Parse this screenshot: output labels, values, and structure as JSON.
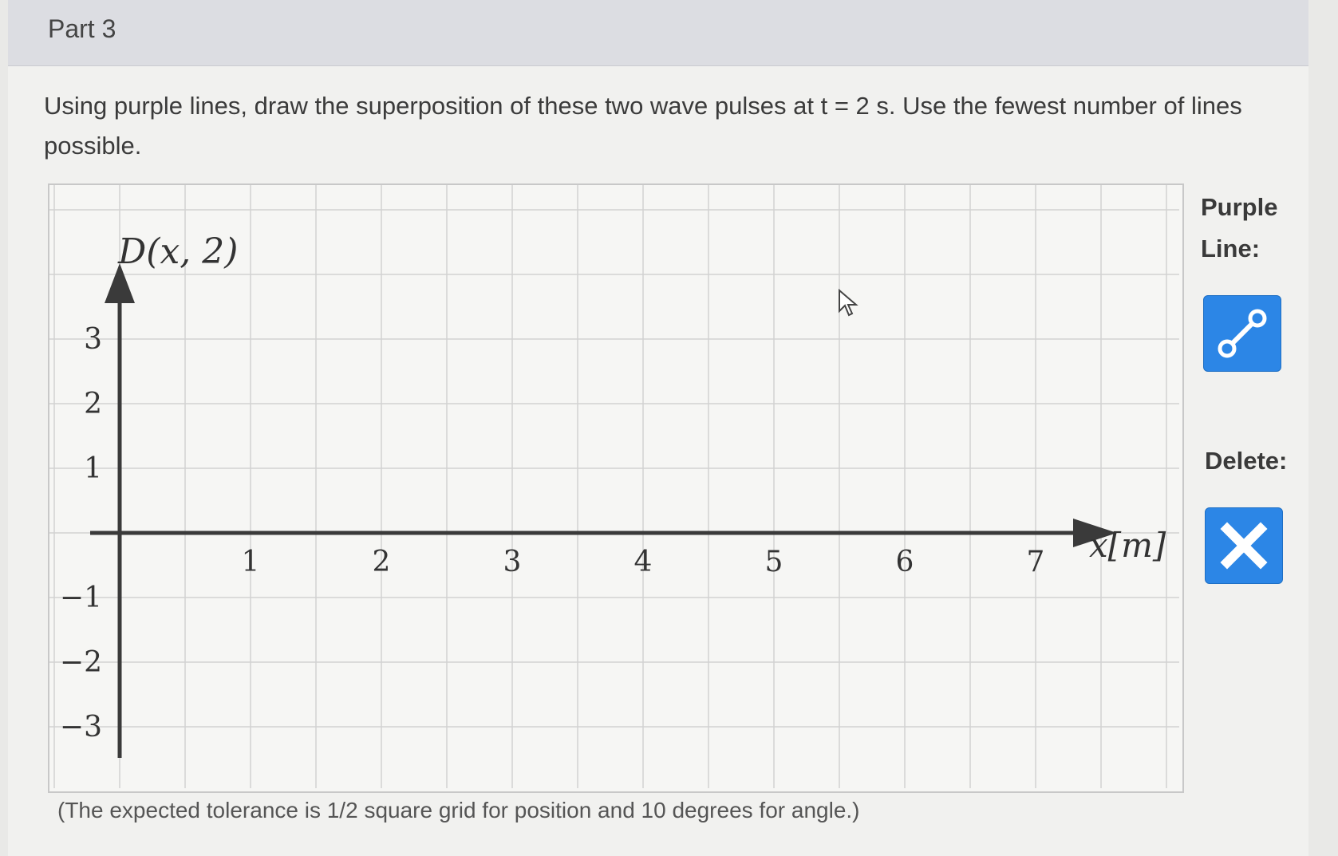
{
  "part": {
    "title": "Part 3"
  },
  "question": {
    "text": "Using purple lines, draw the superposition of these two wave pulses at t = 2 s. Use the fewest number of lines possible."
  },
  "graph": {
    "y_label": "D(x, 2)",
    "x_label": "x[m]",
    "x_ticks": [
      "1",
      "2",
      "3",
      "4",
      "5",
      "6",
      "7"
    ],
    "y_ticks": [
      "3",
      "2",
      "1",
      "−1",
      "−2",
      "−3"
    ]
  },
  "tools": {
    "purple_line_label": "Purple Line:",
    "purple_line_icon": "line-segment-icon",
    "delete_label": "Delete:",
    "delete_icon": "close-icon",
    "button_color": "#2c86e6"
  },
  "footer": {
    "tolerance_text": "(The expected tolerance is 1/2 square grid for position and 10 degrees for angle.)"
  }
}
